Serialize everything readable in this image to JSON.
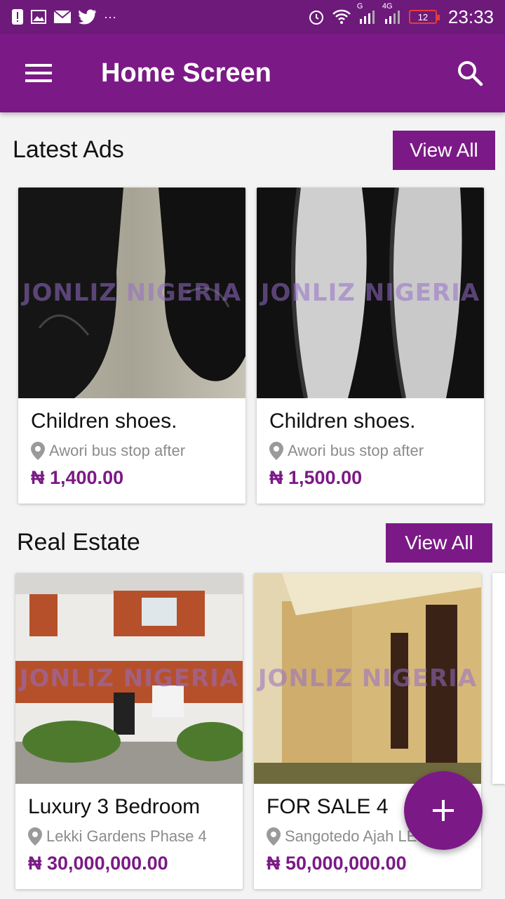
{
  "status_bar": {
    "time": "23:33",
    "battery": "12",
    "notification_icons": [
      "alert-icon",
      "image-icon",
      "mail-icon",
      "twitter-icon",
      "more-icon"
    ],
    "more": "···",
    "signal_1_label": "G",
    "signal_2_label": "4G"
  },
  "app_bar": {
    "title": "Home Screen"
  },
  "sections": [
    {
      "title": "Latest Ads",
      "view_all": "View All",
      "items": [
        {
          "title": "Children shoes.",
          "location": "Awori bus stop after",
          "price": "₦ 1,400.00",
          "watermark": "JONLIZ NIGERIA"
        },
        {
          "title": "Children shoes.",
          "location": "Awori bus stop after",
          "price": "₦ 1,500.00",
          "watermark": "JONLIZ NIGERIA"
        }
      ]
    },
    {
      "title": "Real Estate",
      "view_all": "View All",
      "items": [
        {
          "title": "Luxury 3 Bedroom",
          "location": "Lekki Gardens Phase 4",
          "price": "₦ 30,000,000.00",
          "watermark": "JONLIZ NIGERIA"
        },
        {
          "title": "FOR SALE 4",
          "location": "Sangotedo Ajah LEI",
          "price": "₦ 50,000,000.00",
          "watermark": "JONLIZ NIGERIA"
        }
      ]
    }
  ],
  "colors": {
    "primary": "#7b1a86",
    "status_bar": "#6d1a7a",
    "background": "#f3f3f3",
    "price": "#7b1a86"
  }
}
